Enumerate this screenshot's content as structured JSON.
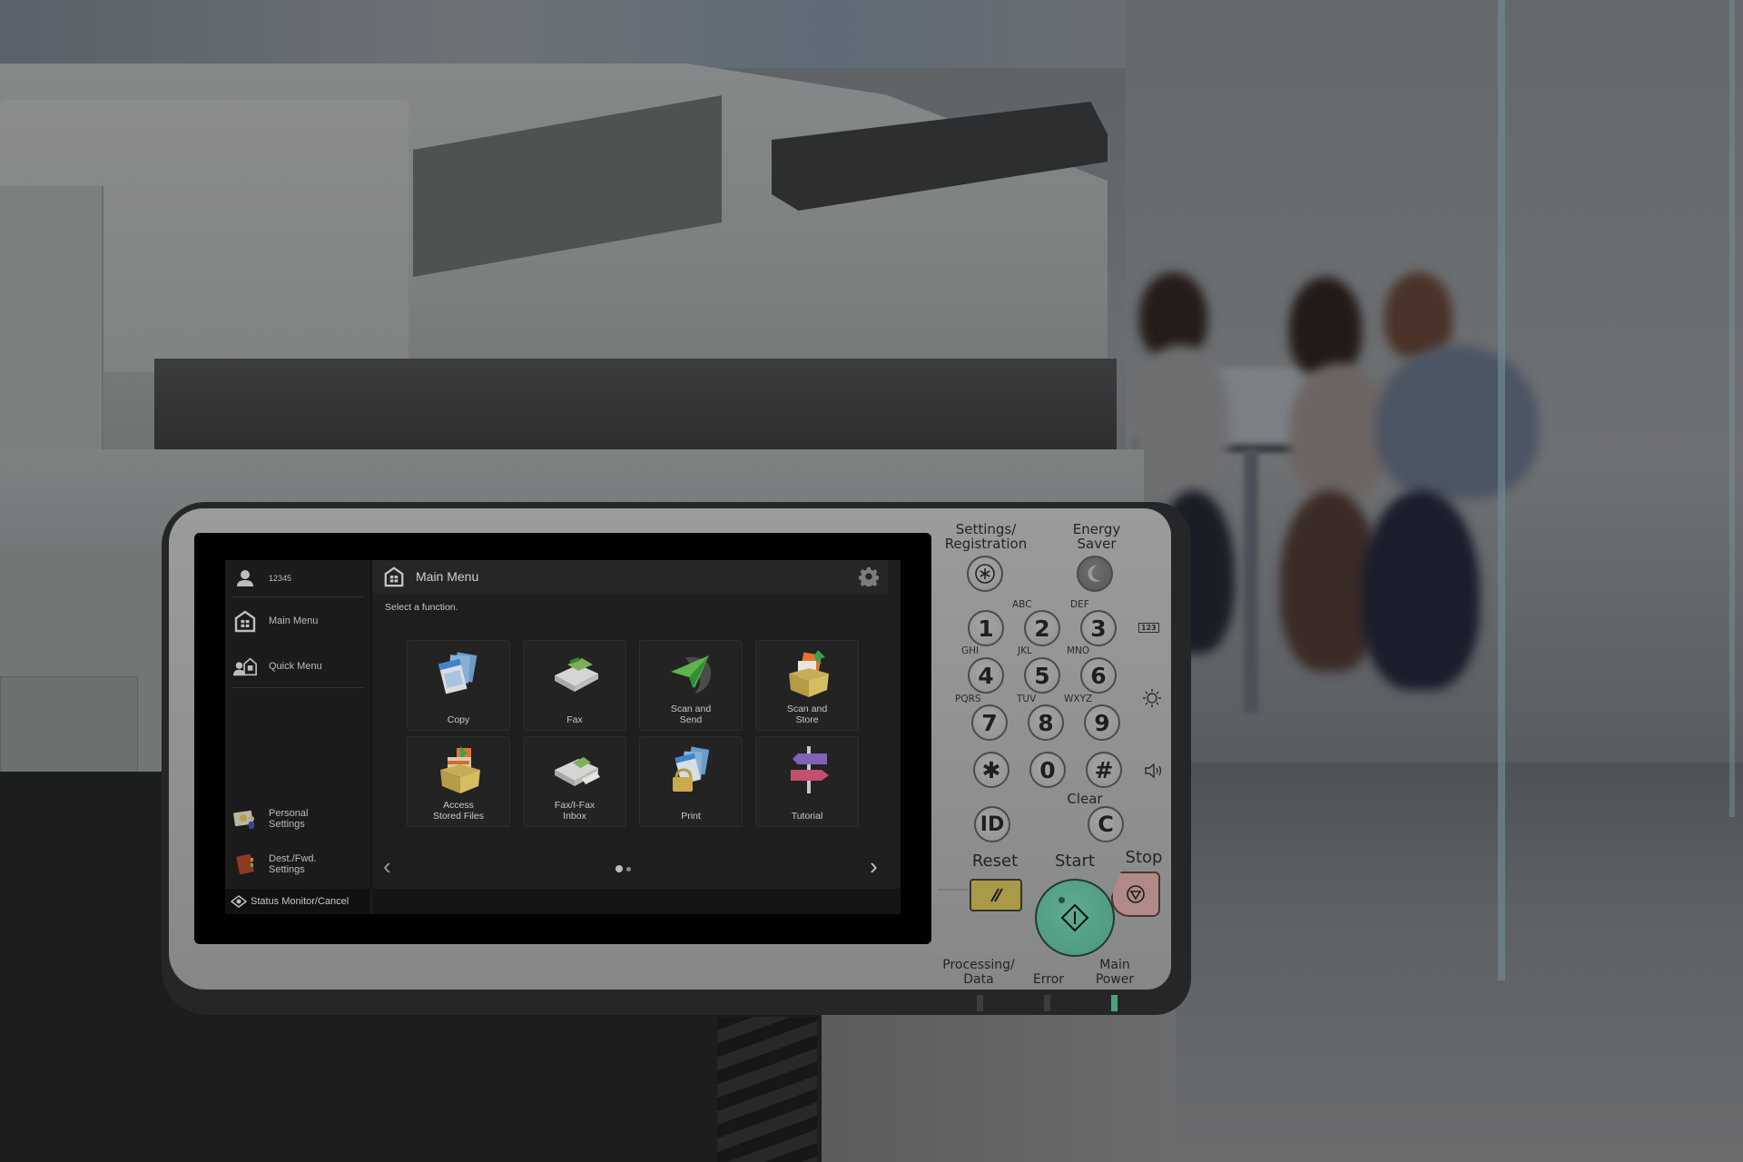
{
  "screen": {
    "sidebar": {
      "user_id": "12345",
      "items": [
        {
          "label": "Main Menu",
          "icon": "home-icon"
        },
        {
          "label": "Quick Menu",
          "icon": "quick-menu-icon"
        }
      ],
      "bottom_items": [
        {
          "label": "Personal\nSettings",
          "icon": "personal-settings-icon"
        },
        {
          "label": "Dest./Fwd.\nSettings",
          "icon": "address-book-icon"
        }
      ],
      "status_button": "Status Monitor/Cancel"
    },
    "main": {
      "title": "Main Menu",
      "instruction": "Select a function.",
      "tiles": [
        {
          "label": "Copy",
          "icon": "copy-icon"
        },
        {
          "label": "Fax",
          "icon": "fax-icon"
        },
        {
          "label": "Scan and\nSend",
          "icon": "scan-send-icon"
        },
        {
          "label": "Scan and\nStore",
          "icon": "scan-store-icon"
        },
        {
          "label": "Access\nStored Files",
          "icon": "stored-files-icon"
        },
        {
          "label": "Fax/I-Fax\nInbox",
          "icon": "fax-inbox-icon"
        },
        {
          "label": "Print",
          "icon": "secure-print-icon"
        },
        {
          "label": "Tutorial",
          "icon": "signpost-icon"
        }
      ],
      "pagination": {
        "current_page": 1,
        "total_pages": 2
      },
      "prev_arrow": "‹",
      "next_arrow": "›"
    }
  },
  "panel": {
    "settings_label": "Settings/\nRegistration",
    "energy_label": "Energy\nSaver",
    "keys": [
      {
        "digit": "1",
        "letters": ""
      },
      {
        "digit": "2",
        "letters": "ABC"
      },
      {
        "digit": "3",
        "letters": "DEF"
      },
      {
        "digit": "4",
        "letters": "GHI"
      },
      {
        "digit": "5",
        "letters": "JKL"
      },
      {
        "digit": "6",
        "letters": "MNO"
      },
      {
        "digit": "7",
        "letters": "PQRS"
      },
      {
        "digit": "8",
        "letters": "TUV"
      },
      {
        "digit": "9",
        "letters": "WXYZ"
      },
      {
        "digit": "✱",
        "letters": ""
      },
      {
        "digit": "0",
        "letters": ""
      },
      {
        "digit": "#",
        "letters": ""
      }
    ],
    "id_key": "ID",
    "clear_label": "Clear",
    "clear_key": "C",
    "reset_label": "Reset",
    "start_label": "Start",
    "stop_label": "Stop",
    "counter_badge": "123",
    "indicators": [
      {
        "label": "Processing/\nData",
        "state": "off"
      },
      {
        "label": "Error",
        "state": "off"
      },
      {
        "label": "Main\nPower",
        "state": "on"
      }
    ],
    "colors": {
      "start": "#4f9a82",
      "reset": "#a99a4a",
      "stop": "#b08a86",
      "power_led": "#4aa37a"
    }
  }
}
